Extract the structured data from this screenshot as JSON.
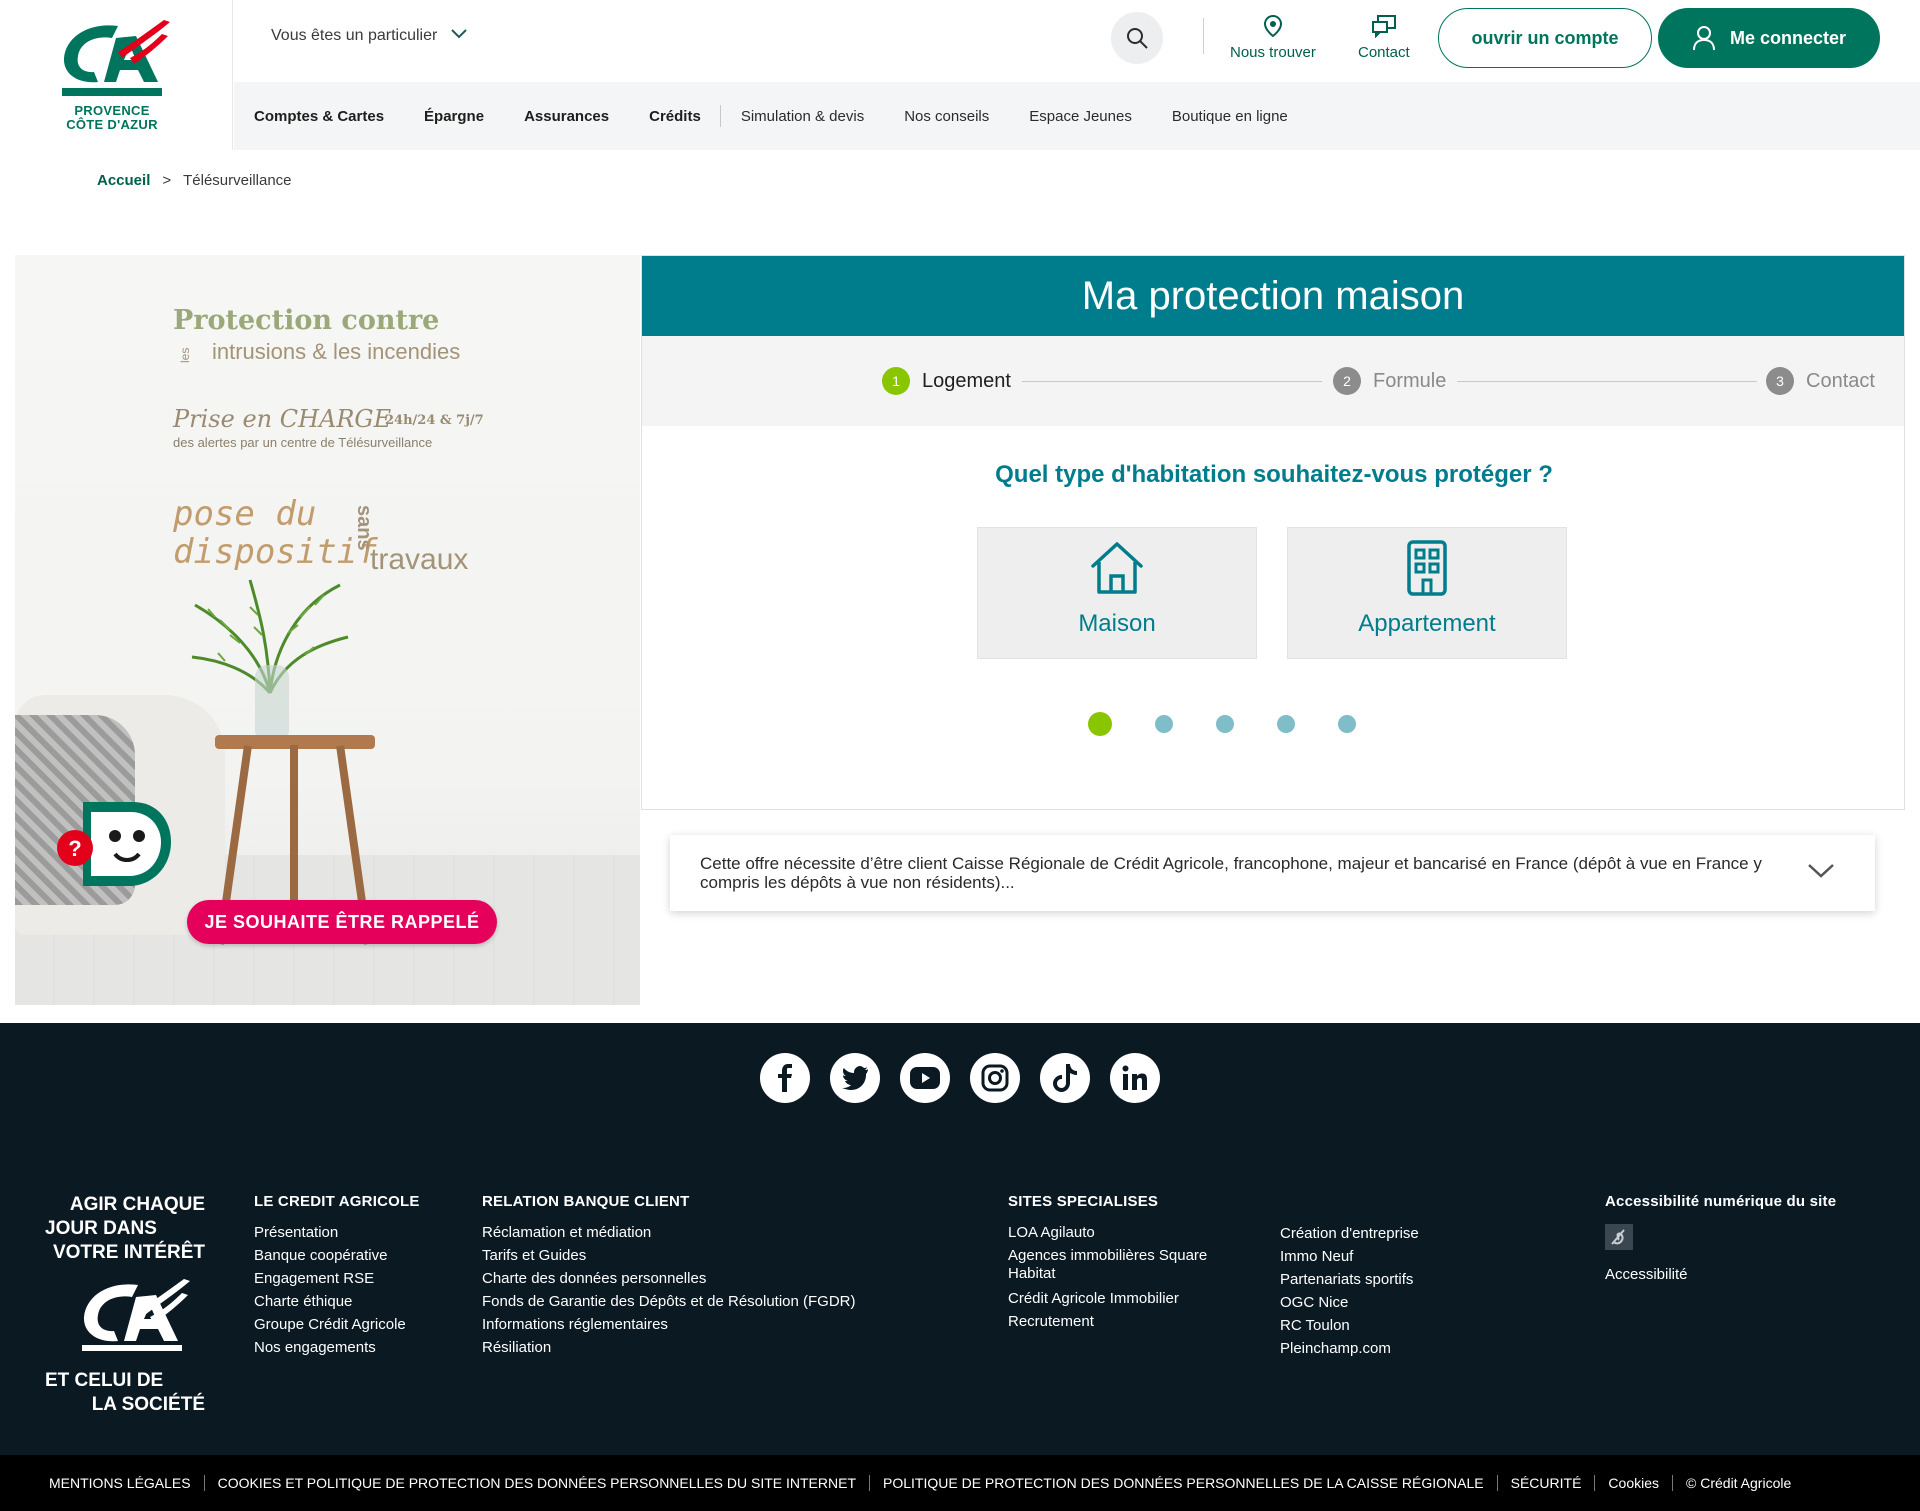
{
  "brand": {
    "region_line1": "PROVENCE",
    "region_line2": "CÔTE D'AZUR",
    "green": "#00755d",
    "red": "#e2001a",
    "teal": "#007d8c",
    "lime": "#8ac600",
    "pink": "#e4005b"
  },
  "header": {
    "persona": "Vous êtes un particulier",
    "search_icon": "search-icon",
    "find_us": "Nous trouver",
    "contact": "Contact",
    "open_account": "ouvrir un compte",
    "login": "Me connecter"
  },
  "nav": {
    "main": [
      "Comptes & Cartes",
      "Épargne",
      "Assurances",
      "Crédits"
    ],
    "secondary": [
      "Simulation & devis",
      "Nos conseils",
      "Espace Jeunes",
      "Boutique en ligne"
    ]
  },
  "breadcrumb": {
    "home": "Accueil",
    "separator": ">",
    "current": "Télésurveillance"
  },
  "hero": {
    "line1": "Protection contre",
    "line2_small": "les",
    "line2": "intrusions & les incendies",
    "line3": "Prise en CHARGE",
    "line3b": "24h/24 & 7j/7",
    "line4": "des alertes par un centre de Télésurveillance",
    "line5a": "pose du",
    "line5b": "dispositif",
    "line6": "travaux",
    "line7": "sans",
    "callback": "JE SOUHAITE ÊTRE RAPPELÉ"
  },
  "form": {
    "title": "Ma protection maison",
    "steps": [
      {
        "num": "1",
        "label": "Logement"
      },
      {
        "num": "2",
        "label": "Formule"
      },
      {
        "num": "3",
        "label": "Contact"
      }
    ],
    "active_step": 1,
    "question": "Quel type d'habitation souhaitez-vous protéger ?",
    "choices": [
      {
        "label": "Maison",
        "icon": "house-icon"
      },
      {
        "label": "Appartement",
        "icon": "building-icon"
      }
    ],
    "pagination_total": 5,
    "pagination_current": 1
  },
  "offer": {
    "text": "Cette offre nécessite d’être client Caisse Régionale de Crédit Agricole, francophone, majeur et bancarisé en France (dépôt à vue en France y compris les dépôts à vue non résidents)..."
  },
  "footer": {
    "socials": [
      "facebook-icon",
      "twitter-icon",
      "youtube-icon",
      "instagram-icon",
      "tiktok-icon",
      "linkedin-icon"
    ],
    "slogan": {
      "l1": "AGIR CHAQUE",
      "l2": "JOUR DANS",
      "l3": "VOTRE INTÉRÊT",
      "l4": "ET CELUI DE",
      "l5": "LA SOCIÉTÉ"
    },
    "col1": {
      "title": "LE CREDIT AGRICOLE",
      "links": [
        "Présentation",
        "Banque coopérative",
        "Engagement RSE",
        "Charte éthique",
        "Groupe Crédit Agricole",
        "Nos engagements"
      ]
    },
    "col2": {
      "title": "RELATION BANQUE CLIENT",
      "links": [
        "Réclamation et médiation",
        "Tarifs et Guides",
        "Charte des données personnelles",
        "Fonds de Garantie des Dépôts et de Résolution (FGDR)",
        "Informations réglementaires",
        "Résiliation"
      ]
    },
    "col3": {
      "title": "SITES SPECIALISES",
      "links": [
        "LOA Agilauto",
        "Agences immobilières Square Habitat",
        "Crédit Agricole Immobilier",
        "Recrutement"
      ]
    },
    "col4": {
      "links": [
        "Création d'entreprise",
        "Immo Neuf",
        "Partenariats sportifs",
        "OGC Nice",
        "RC Toulon",
        "Pleinchamp.com"
      ]
    },
    "col5": {
      "title": "Accessibilité numérique du site",
      "link": "Accessibilité"
    }
  },
  "legal": [
    "MENTIONS LÉGALES",
    "COOKIES ET POLITIQUE DE PROTECTION DES DONNÉES PERSONNELLES DU SITE INTERNET",
    "POLITIQUE DE PROTECTION DES DONNÉES PERSONNELLES DE LA CAISSE RÉGIONALE",
    "SÉCURITÉ",
    "Cookies",
    "© Crédit Agricole"
  ]
}
